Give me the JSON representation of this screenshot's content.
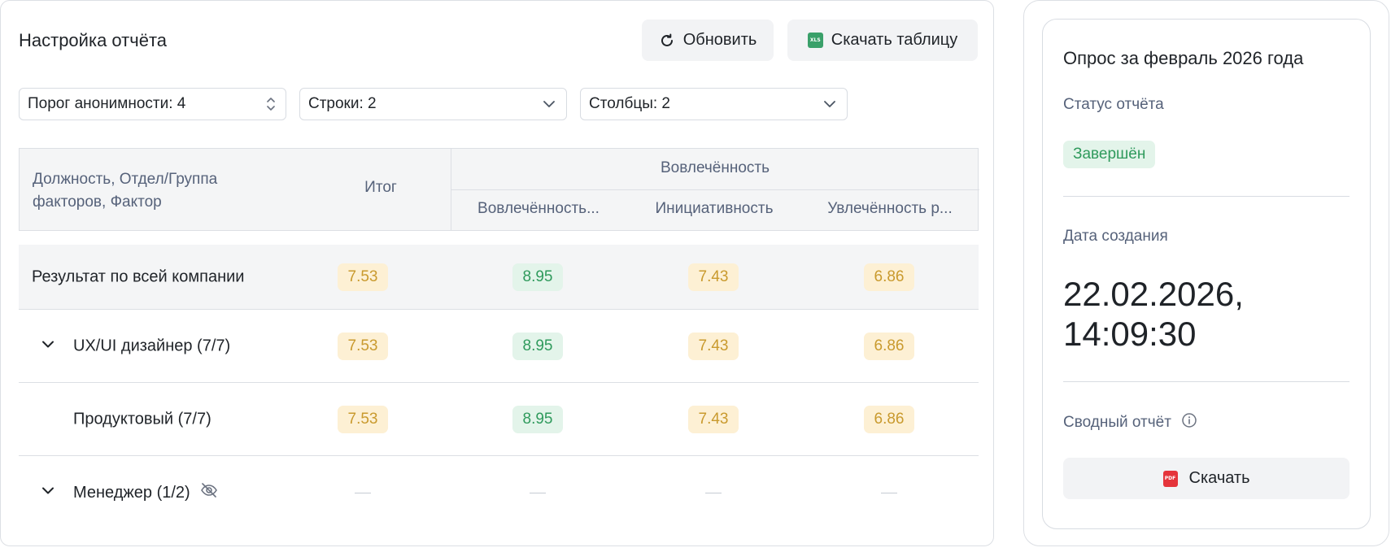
{
  "report": {
    "title": "Настройка отчёта",
    "refresh_label": "Обновить",
    "download_table_label": "Скачать таблицу",
    "xls_icon_text": "XLS",
    "filters": {
      "anonymity": "Порог анонимности: 4",
      "rows": "Строки: 2",
      "columns": "Столбцы: 2"
    },
    "table": {
      "header_first": "Должность, Отдел/Группа факторов, Фактор",
      "header_total": "Итог",
      "header_group": "Вовлечённость",
      "sub_headers": [
        "Вовлечённость...",
        "Инициативность",
        "Увлечённость р..."
      ],
      "rows": [
        {
          "label": "Результат по всей компании",
          "values": [
            "7.53",
            "8.95",
            "7.43",
            "6.86"
          ]
        },
        {
          "label": "UX/UI дизайнер (7/7)",
          "values": [
            "7.53",
            "8.95",
            "7.43",
            "6.86"
          ]
        },
        {
          "label": "Продуктовый (7/7)",
          "values": [
            "7.53",
            "8.95",
            "7.43",
            "6.86"
          ]
        },
        {
          "label": "Менеджер (1/2)",
          "values": [
            "—",
            "—",
            "—",
            "—"
          ]
        }
      ]
    }
  },
  "summary": {
    "survey_title": "Опрос за февраль 2026 года",
    "status_label": "Статус отчёта",
    "status_value": "Завершён",
    "created_label": "Дата создания",
    "created_date_line1": "22.02.2026,",
    "created_date_line2": "14:09:30",
    "summary_label": "Сводный отчёт",
    "download_label": "Скачать",
    "pdf_icon_text": "PDF"
  },
  "colors": {
    "score_yellow_bg": "#fdf0d4",
    "score_yellow_text": "#c99a2e",
    "score_green_bg": "#e3f4ea",
    "score_green_text": "#2f9a5c"
  }
}
